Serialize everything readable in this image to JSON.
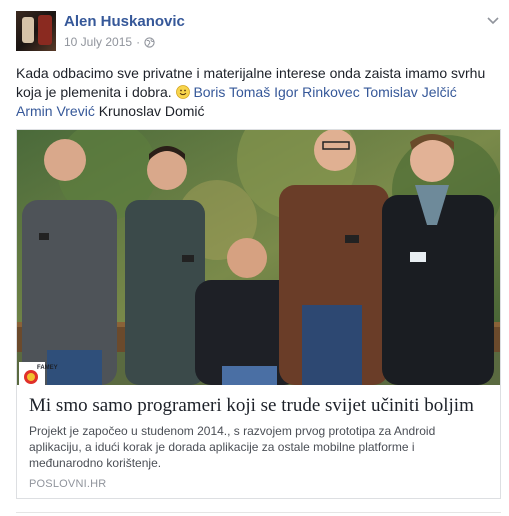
{
  "post": {
    "author": "Alen Huskanovic",
    "date": "10 July 2015",
    "separator": "·",
    "privacy_icon": "globe-icon",
    "options_icon": "chevron-down-icon",
    "text": "Kada odbacimo sve privatne i materijalne interese onda zaista imamo svrhu koja je plemenita i dobra.",
    "emoji": "smile-emoji-icon",
    "tags": [
      "Boris Tomaš",
      "Igor Rinkovec",
      "Tomislav Jelčić",
      "Armin Vrević"
    ],
    "plain_name": "Krunoslav Domić"
  },
  "link_card": {
    "title": "Mi smo samo programeri koji se trude svijet učiniti boljim",
    "description": "Projekt je započeo u studenom 2014., s razvojem prvog prototipa za Android aplikaciju, a idući korak je dorada aplikacije za ostale mobilne platforme i međunarodno korištenje.",
    "source": "POSLOVNI.HR",
    "logo_text": "FAMEY"
  },
  "colors": {
    "link": "#365899",
    "text": "#1d2129",
    "meta": "#90949c"
  }
}
